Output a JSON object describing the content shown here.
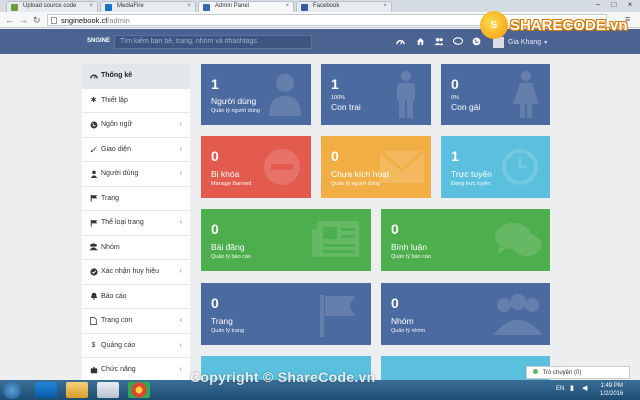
{
  "browser": {
    "tabs": [
      {
        "label": "Upload source code",
        "color": "#6a9e3a"
      },
      {
        "label": "MediaFire",
        "color": "#1b73c8"
      },
      {
        "label": "Admin Panel",
        "color": "#3b6ab0"
      },
      {
        "label": "Facebook",
        "color": "#3b5998"
      }
    ],
    "url_domain": "snginebook.cf",
    "url_path": "/admin"
  },
  "watermark": {
    "logo_text": "SHARECODE.vn",
    "copyright": "Copyright © ShareCode.vn"
  },
  "topnav": {
    "brand": "SNGINE",
    "search_placeholder": "Tìm kiếm bạn bè, trang, nhóm và #hashtags",
    "user_name": "Gia Khang",
    "icons": [
      "dashboard-icon",
      "home-icon",
      "friends-icon",
      "messages-icon",
      "globe-icon"
    ]
  },
  "sidebar": {
    "items": [
      {
        "label": "Thống kê",
        "icon": "dashboard-icon",
        "chevron": false
      },
      {
        "label": "Thiết lập",
        "icon": "gear-icon",
        "chevron": false
      },
      {
        "label": "Ngôn ngữ",
        "icon": "globe-icon",
        "chevron": true
      },
      {
        "label": "Giao diện",
        "icon": "brush-icon",
        "chevron": true
      },
      {
        "label": "Người dùng",
        "icon": "user-icon",
        "chevron": true
      },
      {
        "label": "Trang",
        "icon": "flag-icon",
        "chevron": false
      },
      {
        "label": "Thể loại trang",
        "icon": "flag-icon",
        "chevron": true
      },
      {
        "label": "Nhóm",
        "icon": "group-icon",
        "chevron": false
      },
      {
        "label": "Xác nhận huy hiệu",
        "icon": "check-circle-icon",
        "chevron": true
      },
      {
        "label": "Báo cáo",
        "icon": "bell-icon",
        "chevron": false
      },
      {
        "label": "Trang con",
        "icon": "file-icon",
        "chevron": true
      },
      {
        "label": "Quảng cáo",
        "icon": "dollar-icon",
        "chevron": true
      },
      {
        "label": "Chức năng",
        "icon": "puzzle-icon",
        "chevron": true
      }
    ]
  },
  "cards": {
    "users": {
      "value": "1",
      "title": "Người dùng",
      "sub": "Quản lý người dùng",
      "color": "#4b6aa0"
    },
    "male": {
      "value": "1",
      "pct": "100%",
      "title": "Con trai",
      "color": "#4b6aa0"
    },
    "female": {
      "value": "0",
      "pct": "0%",
      "title": "Con gái",
      "color": "#4b6aa0"
    },
    "banned": {
      "value": "0",
      "title": "Bị khóa",
      "sub": "Manage Banned",
      "color": "#e35b4e"
    },
    "inactive": {
      "value": "0",
      "title": "Chưa kích hoạt",
      "sub": "Quản lý người dùng",
      "color": "#f0ae45"
    },
    "online": {
      "value": "1",
      "title": "Trực tuyến",
      "sub": "Đang trực tuyến",
      "color": "#5bc0de"
    },
    "posts": {
      "value": "0",
      "title": "Bài đăng",
      "sub": "Quản lý báo cáo",
      "color": "#4cae4c"
    },
    "comments": {
      "value": "0",
      "title": "Bình luận",
      "sub": "Quản lý báo cáo",
      "color": "#4cae4c"
    },
    "pages": {
      "value": "0",
      "title": "Trang",
      "sub": "Quản lý trang",
      "color": "#4b6aa0"
    },
    "groups": {
      "value": "0",
      "title": "Nhóm",
      "sub": "Quản lý nhóm",
      "color": "#4b6aa0"
    }
  },
  "chat": {
    "label": "Trò chuyện (0)"
  },
  "taskbar": {
    "lang": "EN",
    "time": "1:49 PM",
    "date": "1/2/2016"
  }
}
